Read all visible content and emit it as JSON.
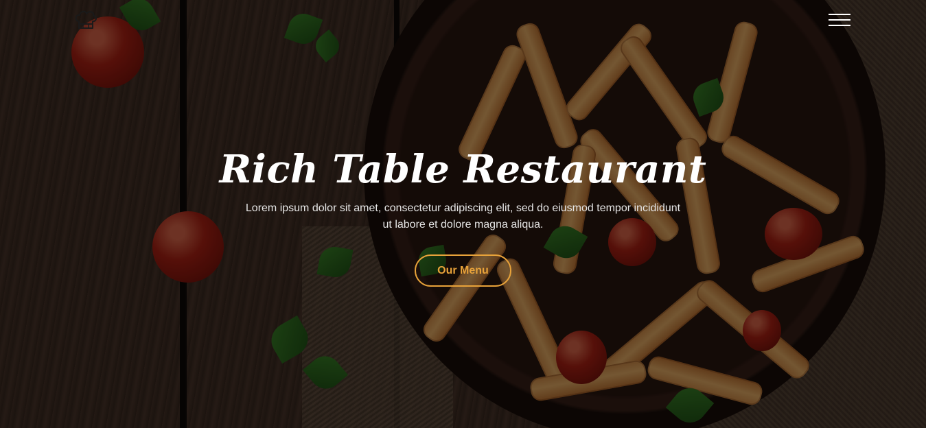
{
  "header": {
    "logo_icon": "chef-hat-icon",
    "menu_icon": "hamburger-menu-icon"
  },
  "hero": {
    "title": "Rich Table Restaurant",
    "text": "Lorem ipsum dolor sit amet, consectetur adipiscing elit, sed do eiusmod tempor incididunt ut labore et dolore magna aliqua.",
    "button_label": "Our Menu"
  },
  "colors": {
    "accent": "#e9a33a",
    "title": "#ffffff",
    "overlay": "rgba(0,0,0,0.52)"
  }
}
